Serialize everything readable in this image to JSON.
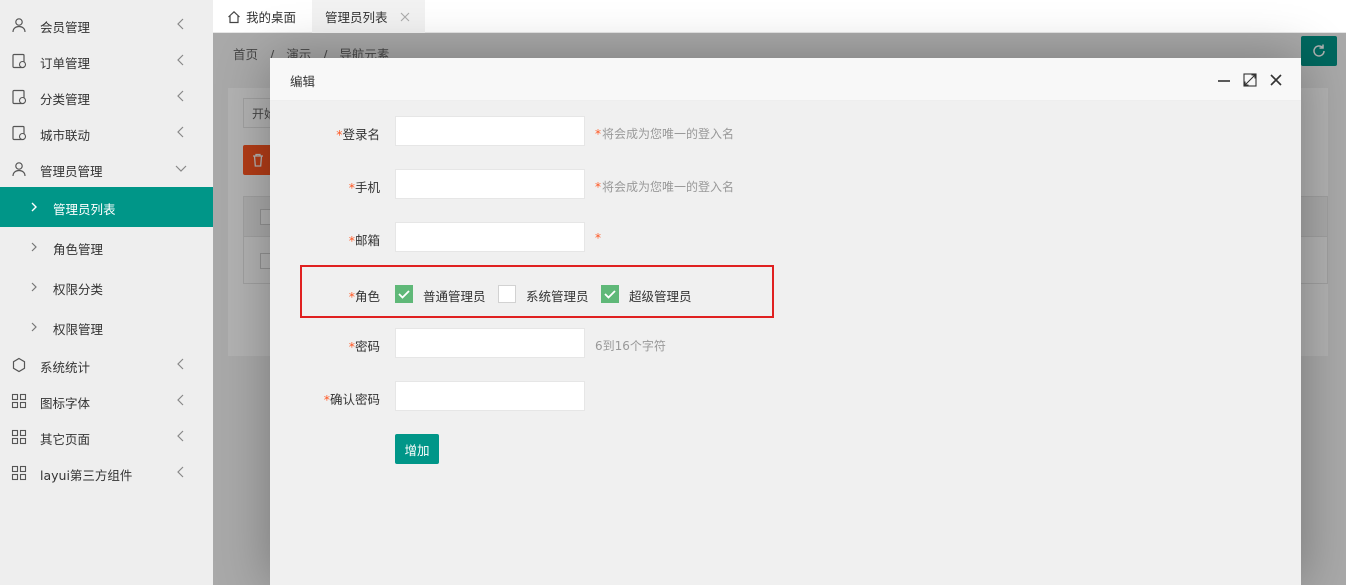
{
  "sidebar": {
    "items": [
      {
        "label": "会员管理",
        "icon": "user-icon"
      },
      {
        "label": "订单管理",
        "icon": "order-icon"
      },
      {
        "label": "分类管理",
        "icon": "category-icon"
      },
      {
        "label": "城市联动",
        "icon": "city-icon"
      },
      {
        "label": "管理员管理",
        "icon": "admin-icon"
      },
      {
        "label": "管理员列表",
        "active": true
      },
      {
        "label": "角色管理"
      },
      {
        "label": "权限分类"
      },
      {
        "label": "权限管理"
      },
      {
        "label": "系统统计",
        "icon": "stats-icon"
      },
      {
        "label": "图标字体",
        "icon": "grid-icon"
      },
      {
        "label": "其它页面",
        "icon": "grid-icon"
      },
      {
        "label": "layui第三方组件",
        "icon": "grid-icon"
      }
    ]
  },
  "tabs": {
    "home": "我的桌面",
    "current": "管理员列表"
  },
  "breadcrumb": [
    "首页",
    "/",
    "演示",
    "/",
    "导航元素"
  ],
  "background": {
    "start_input": "开始"
  },
  "dialog": {
    "title": "编辑",
    "fields": {
      "login": {
        "label": "登录名",
        "hint": "将会成为您唯一的登入名",
        "value": ""
      },
      "phone": {
        "label": "手机",
        "hint": "将会成为您唯一的登入名",
        "value": ""
      },
      "email": {
        "label": "邮箱",
        "hint": "",
        "value": ""
      },
      "role": {
        "label": "角色"
      },
      "password": {
        "label": "密码",
        "hint": "6到16个字符",
        "value": ""
      },
      "confirm": {
        "label": "确认密码",
        "value": ""
      }
    },
    "required_mark": "*",
    "roles": [
      {
        "label": "普通管理员",
        "checked": true
      },
      {
        "label": "系统管理员",
        "checked": false
      },
      {
        "label": "超级管理员",
        "checked": true
      }
    ],
    "submit_label": "增加"
  },
  "colors": {
    "accent": "#009688",
    "checked": "#5fb878",
    "danger": "#ff5722",
    "highlight_box": "#e02020"
  }
}
